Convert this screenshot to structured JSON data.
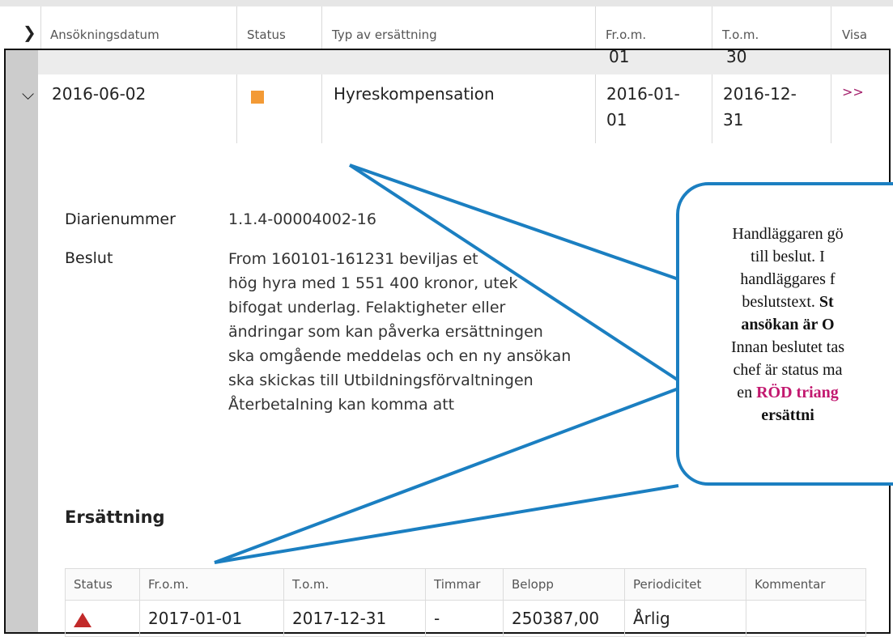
{
  "header": {
    "columns": [
      "Ansökningsdatum",
      "Status",
      "Typ av ersättning",
      "Fr.o.m.",
      "T.o.m.",
      "Visa"
    ]
  },
  "prev_row": {
    "from_frag": "01",
    "to_frag": "30"
  },
  "row": {
    "date": "2016-06-02",
    "status_color": "#f39a35",
    "type": "Hyreskompensation",
    "from_line1": "2016-01-",
    "from_line2": "01",
    "to_line1": "2016-12-",
    "to_line2": "31",
    "visa": ">>"
  },
  "details": {
    "diarie_label": "Diarienummer",
    "diarie_value": "1.1.4-00004002-16",
    "beslut_label": "Beslut",
    "beslut_lines": [
      "From 160101-161231 beviljas et",
      "hög hyra med 1 551 400 kronor, utek",
      "bifogat underlag. Felaktigheter eller",
      "ändringar som kan påverka ersättningen",
      "ska omgående meddelas och en ny ansökan",
      "ska skickas till Utbildningsförvaltningen",
      "Återbetalning kan komma att"
    ]
  },
  "ersattning": {
    "title": "Ersättning",
    "columns": [
      "Status",
      "Fr.o.m.",
      "T.o.m.",
      "Timmar",
      "Belopp",
      "Periodicitet",
      "Kommentar"
    ],
    "row": {
      "from": "2017-01-01",
      "to": "2017-12-31",
      "hours": "-",
      "amount": "250387,00",
      "period": "Årlig",
      "comment": ""
    }
  },
  "callout": {
    "line1": "Handläggaren gö",
    "line2": "till beslut. I",
    "line3": "handläggares f",
    "line4_a": "beslutstext. ",
    "line4_b": "St",
    "line5": "ansökan är O",
    "line6": "Innan beslutet tas",
    "line7": "chef är status ma",
    "line8_a": "en ",
    "line8_b": "RÖD triang",
    "line9": "ersättni",
    "border_color": "#1b7fc1",
    "highlight_color": "#c2186f"
  }
}
